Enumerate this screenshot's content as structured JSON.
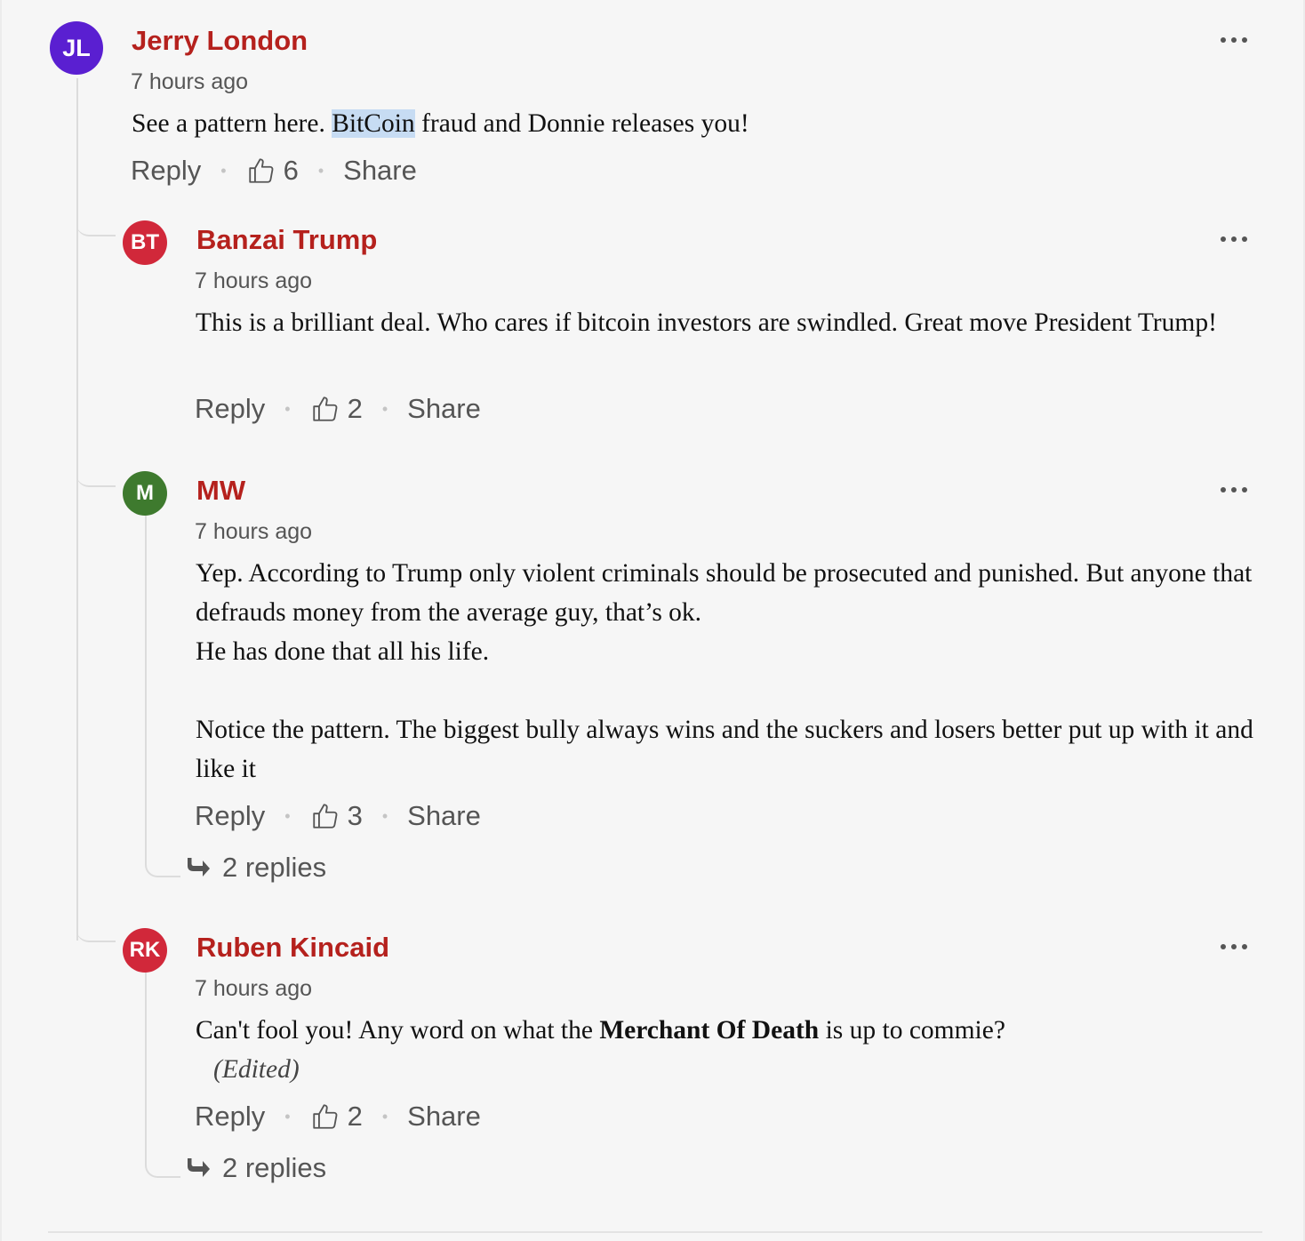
{
  "comments": [
    {
      "initials": "JL",
      "avatar_color": "#5a1fd1",
      "author": "Jerry London",
      "time": "7 hours ago",
      "text_before": "See a pattern here. ",
      "text_highlight": "BitCoin",
      "text_after": " fraud and Donnie releases you!",
      "reply_label": "Reply",
      "likes": "6",
      "share_label": "Share"
    },
    {
      "initials": "BT",
      "avatar_color": "#d1283a",
      "author": "Banzai Trump",
      "time": "7 hours ago",
      "text": "This is a brilliant deal. Who cares if bitcoin investors are swindled. Great move President Trump!",
      "reply_label": "Reply",
      "likes": "2",
      "share_label": "Share"
    },
    {
      "initials": "M",
      "avatar_color": "#3e7a2e",
      "author": "MW",
      "time": "7 hours ago",
      "text_p1_line1": "Yep. According to Trump only violent criminals should be prosecuted and punished. But anyone that defrauds money from the average guy, that’s ok.",
      "text_p1_line2": "He has done that all his life.",
      "text_p2": "Notice the pattern. The biggest bully always wins and the suckers and losers better put up with it and like it",
      "reply_label": "Reply",
      "likes": "3",
      "share_label": "Share",
      "replies_label": "2 replies"
    },
    {
      "initials": "RK",
      "avatar_color": "#d1283a",
      "author": "Ruben Kincaid",
      "time": "7 hours ago",
      "text_before": "Can't fool you! Any word on what the ",
      "text_bold": "Merchant Of Death",
      "text_after": " is up to commie?",
      "edited": "(Edited)",
      "reply_label": "Reply",
      "likes": "2",
      "share_label": "Share",
      "replies_label": "2 replies"
    }
  ],
  "icons": {
    "more": "more-options-icon",
    "like": "thumbs-up-icon",
    "replies": "reply-arrow-icon"
  }
}
